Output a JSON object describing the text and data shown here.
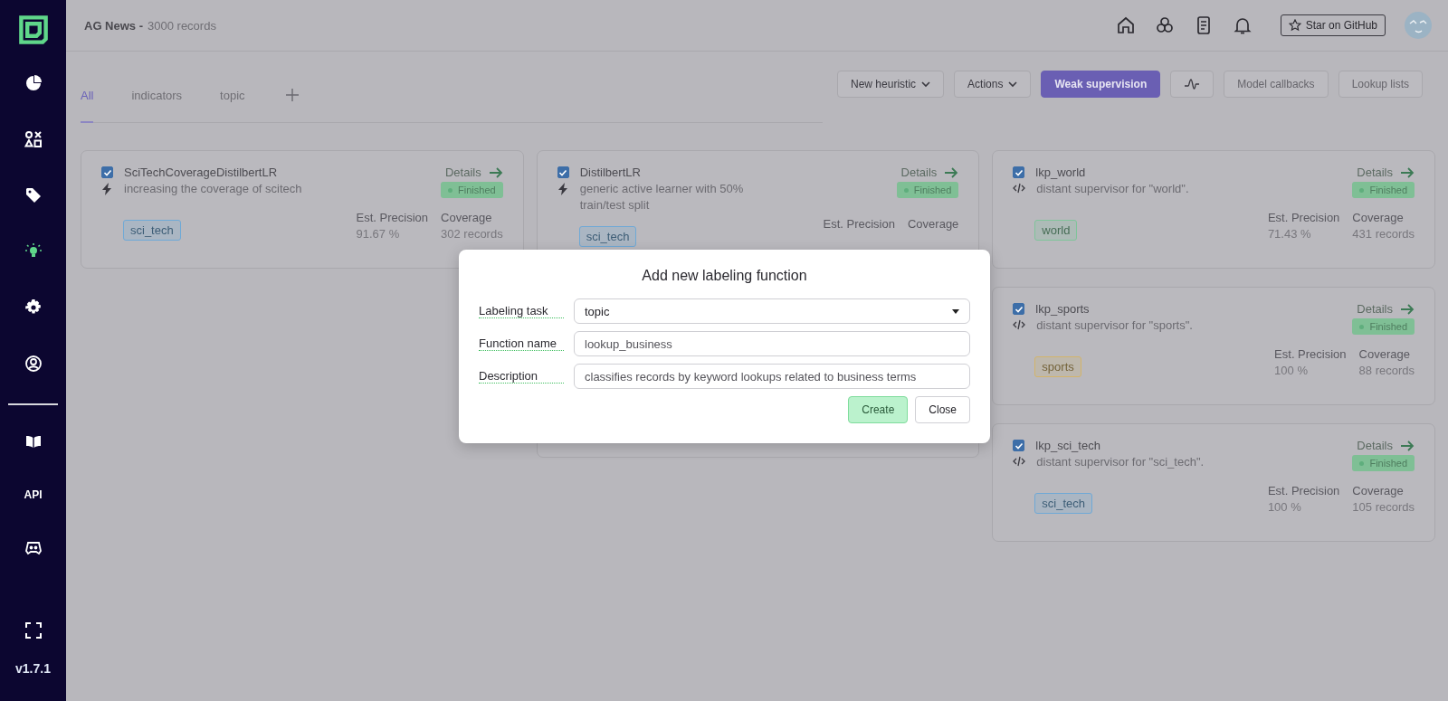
{
  "sidebar": {
    "items": [
      {
        "kind": "logo"
      },
      {
        "kind": "icon",
        "selected": false
      },
      {
        "kind": "icon",
        "selected": false
      },
      {
        "kind": "icon",
        "selected": false
      },
      {
        "kind": "icon",
        "selected": true
      },
      {
        "kind": "icon",
        "selected": false
      },
      {
        "kind": "icon",
        "selected": false
      },
      {
        "kind": "divider"
      },
      {
        "kind": "icon",
        "selected": false
      },
      {
        "kind": "text",
        "label": "API",
        "selected": false
      },
      {
        "kind": "icon",
        "selected": false
      },
      {
        "kind": "spacer"
      },
      {
        "kind": "icon",
        "selected": false
      }
    ],
    "version": "v1.7.1"
  },
  "header": {
    "project": "AG News -",
    "records": "3000 records",
    "star_button": "Star on GitHub"
  },
  "tabs": [
    {
      "label": "All",
      "selected": true
    },
    {
      "label": "indicators",
      "selected": false
    },
    {
      "label": "topic",
      "selected": false
    }
  ],
  "toolbar": [
    {
      "kind": "dropdown",
      "label": "New heuristic"
    },
    {
      "kind": "dropdown",
      "label": "Actions"
    },
    {
      "kind": "primary",
      "label": "Weak supervision"
    },
    {
      "kind": "icon"
    },
    {
      "kind": "plain",
      "label": "Model callbacks"
    },
    {
      "kind": "plain",
      "label": "Lookup lists"
    }
  ],
  "columns": [
    [
      {
        "name": "SciTechCoverageDistilbertLR",
        "checked": true,
        "kind": "active_learner",
        "description": "increasing the coverage of scitech",
        "details": "Details",
        "status": "Finished",
        "tag": {
          "text": "sci_tech",
          "color": "#6fa9d6"
        },
        "precision_label": "Est. Precision",
        "precision": "91.67 %",
        "coverage_label": "Coverage",
        "coverage": "302 records"
      }
    ],
    [
      {
        "name": "DistilbertLR",
        "checked": true,
        "kind": "active_learner",
        "description": "generic active learner with 50% train/test split",
        "details": "Details",
        "status": "Finished",
        "tag": {
          "text": "sci_tech",
          "color": "#6fa9d6"
        },
        "precision_label": "Est. Precision",
        "coverage_label": "Coverage"
      }
    ],
    [
      {
        "name": "lkp_world",
        "checked": true,
        "kind": "lookup",
        "description": "distant supervisor for \"world\".",
        "details": "Details",
        "status": "Finished",
        "tag": {
          "text": "world",
          "color": "#7fc49a"
        },
        "precision_label": "Est. Precision",
        "precision": "71.43 %",
        "coverage_label": "Coverage",
        "coverage": "431 records"
      },
      {
        "name": "lkp_sports",
        "checked": true,
        "kind": "lookup",
        "description": "distant supervisor for \"sports\".",
        "details": "Details",
        "status": "Finished",
        "tag": {
          "text": "sports",
          "color": "#d3b46a"
        },
        "precision_label": "Est. Precision",
        "precision": "100 %",
        "coverage_label": "Coverage",
        "coverage": "88 records"
      },
      {
        "name": "lkp_sci_tech",
        "checked": true,
        "kind": "lookup",
        "description": "distant supervisor for \"sci_tech\".",
        "details": "Details",
        "status": "Finished",
        "tag": {
          "text": "sci_tech",
          "color": "#6fa9d6"
        },
        "precision_label": "Est. Precision",
        "precision": "100 %",
        "coverage_label": "Coverage",
        "coverage": "105 records"
      }
    ]
  ],
  "modal": {
    "title": "Add new labeling function",
    "fields": [
      {
        "label": "Labeling task",
        "kind": "select",
        "value": "topic"
      },
      {
        "label": "Function name",
        "kind": "text",
        "value": "lookup_business"
      },
      {
        "label": "Description",
        "kind": "text",
        "value": "classifies records by keyword lookups related to business terms"
      }
    ],
    "buttons": [
      {
        "label": "Create",
        "kind": "primary"
      },
      {
        "label": "Close",
        "kind": "plain"
      }
    ]
  }
}
